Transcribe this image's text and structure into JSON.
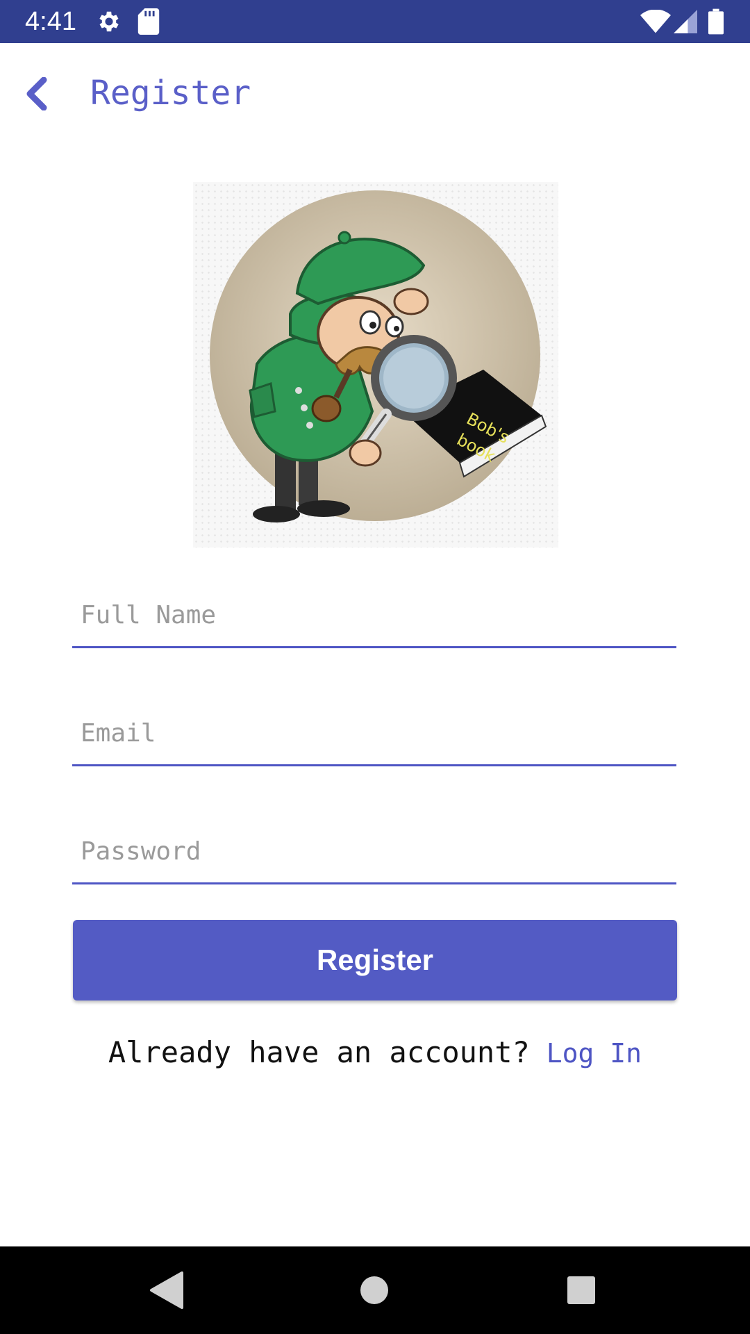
{
  "status_bar": {
    "time": "4:41",
    "icons": [
      "settings-icon",
      "sd-card-icon",
      "wifi-icon",
      "signal-icon",
      "battery-icon"
    ],
    "background": "#303F8F"
  },
  "app_bar": {
    "back_icon": "chevron-left-icon",
    "title": "Register",
    "accent": "#5A5FC8"
  },
  "logo": {
    "book_text_line1": "Bob's",
    "book_text_line2": "book"
  },
  "form": {
    "full_name": {
      "placeholder": "Full Name",
      "value": ""
    },
    "email": {
      "placeholder": "Email",
      "value": ""
    },
    "password": {
      "placeholder": "Password",
      "value": ""
    },
    "register_label": "Register",
    "button_color": "#535BC4"
  },
  "footer": {
    "question": "Already have an account?",
    "login_label": "Log In"
  },
  "nav_bar": {
    "icons": [
      "back-triangle-icon",
      "home-circle-icon",
      "recents-square-icon"
    ]
  }
}
